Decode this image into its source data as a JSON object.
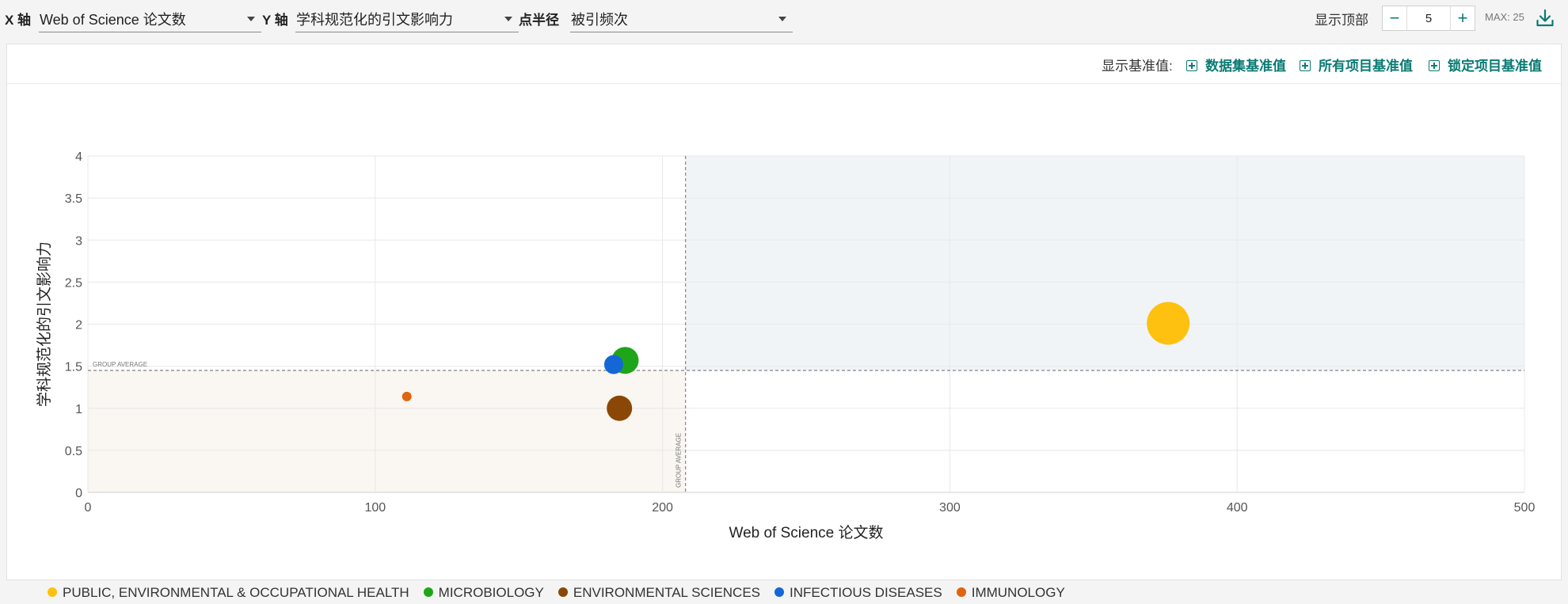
{
  "toolbar": {
    "x_axis_label": "X 轴",
    "x_axis_value": "Web of Science 论文数",
    "y_axis_label": "Y 轴",
    "y_axis_value": "学科规范化的引文影响力",
    "radius_label": "点半径",
    "radius_value": "被引频次",
    "top_n_label": "显示顶部",
    "top_n_value": "5",
    "max_label": "MAX: 25",
    "minus_symbol": "−",
    "plus_symbol": "+"
  },
  "benchmarks": {
    "label": "显示基准值:",
    "dataset": "数据集基准值",
    "all_items": "所有项目基准值",
    "locked_items": "锁定项目基准值"
  },
  "chart_data": {
    "type": "scatter",
    "xlabel": "Web of Science 论文数",
    "ylabel": "学科规范化的引文影响力",
    "xlim": [
      0,
      500
    ],
    "ylim": [
      0,
      4
    ],
    "x_ticks": [
      0,
      100,
      200,
      300,
      400,
      500
    ],
    "y_ticks": [
      0,
      0.5,
      1,
      1.5,
      2,
      2.5,
      3,
      3.5,
      4
    ],
    "grid": true,
    "size_variable": "被引频次",
    "average_lines": {
      "x": 208,
      "y": 1.45,
      "label": "GROUP AVERAGE"
    },
    "quadrant_colors": {
      "high": "#f1f4f7",
      "low": "#faf6f1"
    },
    "series": [
      {
        "name": "PUBLIC, ENVIRONMENTAL & OCCUPATIONAL HEALTH",
        "color": "#fec10f",
        "x": 376,
        "y": 2.01,
        "size": 27
      },
      {
        "name": "MICROBIOLOGY",
        "color": "#1fa51a",
        "x": 187,
        "y": 1.57,
        "size": 17
      },
      {
        "name": "ENVIRONMENTAL SCIENCES",
        "color": "#8a4705",
        "x": 185,
        "y": 1.0,
        "size": 16
      },
      {
        "name": "INFECTIOUS DISEASES",
        "color": "#1567d6",
        "x": 183,
        "y": 1.52,
        "size": 12
      },
      {
        "name": "IMMUNOLOGY",
        "color": "#e0640e",
        "x": 111,
        "y": 1.14,
        "size": 6
      }
    ]
  }
}
